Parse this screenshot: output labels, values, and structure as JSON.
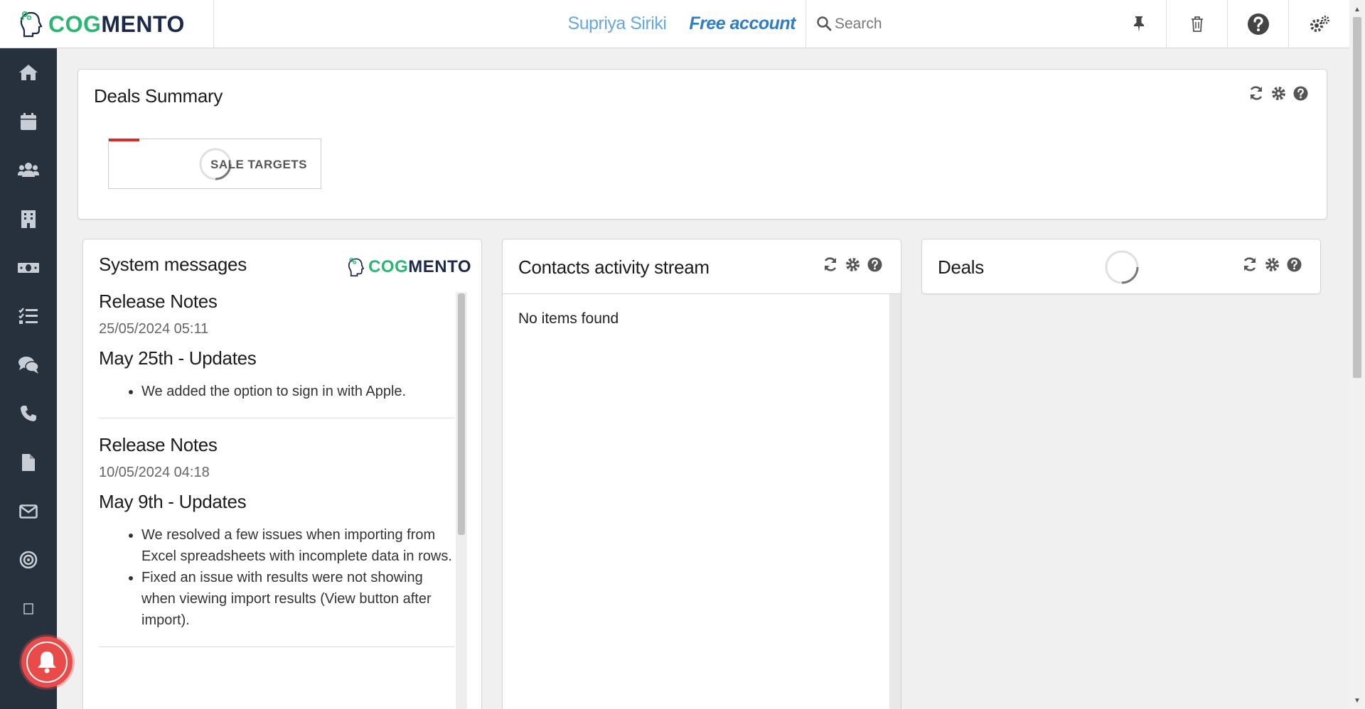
{
  "app": {
    "logo_cog": "COG",
    "logo_mento": "MENTO"
  },
  "header": {
    "user_name": "Supriya Siriki",
    "account_type": "Free account",
    "search_placeholder": "Search",
    "icons": [
      "pin-icon",
      "trash-icon",
      "help-icon",
      "settings-icon"
    ]
  },
  "sidebar": {
    "items": [
      {
        "icon": "home-icon"
      },
      {
        "icon": "calendar-icon"
      },
      {
        "icon": "contacts-icon"
      },
      {
        "icon": "companies-icon"
      },
      {
        "icon": "deals-icon"
      },
      {
        "icon": "tasks-icon"
      },
      {
        "icon": "cases-icon"
      },
      {
        "icon": "calls-icon"
      },
      {
        "icon": "documents-icon"
      },
      {
        "icon": "email-icon"
      },
      {
        "icon": "campaigns-icon"
      },
      {
        "icon": "forms-icon"
      }
    ]
  },
  "deals_summary": {
    "title": "Deals Summary",
    "sale_targets_label": "SALE TARGETS"
  },
  "system_messages": {
    "title": "System messages",
    "messages": [
      {
        "type": "Release Notes",
        "date": "25/05/2024 05:11",
        "headline": "May 25th - Updates",
        "items": [
          "We added the option to sign in with Apple."
        ]
      },
      {
        "type": "Release Notes",
        "date": "10/05/2024 04:18",
        "headline": "May 9th - Updates",
        "items": [
          "We resolved a few issues when importing from Excel spreadsheets with incomplete data in rows.",
          "Fixed an issue with results were not showing when viewing import results (View button after import)."
        ]
      }
    ]
  },
  "contacts_activity": {
    "title": "Contacts activity stream",
    "empty_text": "No items found"
  },
  "deals": {
    "title": "Deals"
  },
  "colors": {
    "sidebar_bg": "#27313e",
    "brand_green": "#2bb673",
    "brand_navy": "#1b2a4a",
    "user_name": "#67a8e0",
    "account_type": "#2f7dc8",
    "notification": "#e94b4b",
    "sale_target_accent": "#db2828"
  }
}
